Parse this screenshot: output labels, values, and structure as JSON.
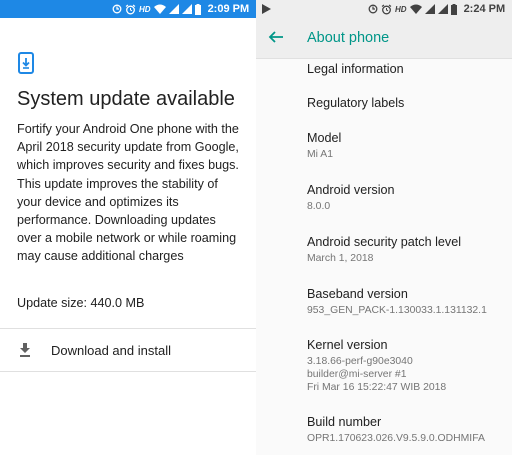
{
  "left_panel": {
    "status_bar": {
      "time": "2:09 PM",
      "network": "HD"
    },
    "title": "System update available",
    "description": "Fortify your Android One phone with the April 2018 security update from Google, which improves security and fixes bugs. This update improves the stability of your device and optimizes its performance. Downloading updates over a mobile network or while roaming may cause additional charges",
    "update_size": "Update size: 440.0 MB",
    "download_button": "Download and install",
    "colors": {
      "status_bar": "#1e88e5",
      "icon": "#1e88e5"
    }
  },
  "right_panel": {
    "status_bar": {
      "time": "2:24 PM",
      "network": "HD"
    },
    "title": "About phone",
    "items": [
      {
        "title": "Legal information"
      },
      {
        "title": "Regulatory labels"
      },
      {
        "title": "Model",
        "summary": "Mi A1"
      },
      {
        "title": "Android version",
        "summary": "8.0.0"
      },
      {
        "title": "Android security patch level",
        "summary": "March 1, 2018"
      },
      {
        "title": "Baseband version",
        "summary": "953_GEN_PACK-1.130033.1.131132.1"
      },
      {
        "title": "Kernel version",
        "summary_lines": [
          "3.18.66-perf-g90e3040",
          "builder@mi-server #1",
          "Fri Mar 16 15:22:47 WIB 2018"
        ]
      },
      {
        "title": "Build number",
        "summary": "OPR1.170623.026.V9.5.9.0.ODHMIFA"
      }
    ],
    "colors": {
      "accent": "#009688",
      "app_bar": "#eeeeee"
    }
  },
  "icons": [
    "phone-download-icon",
    "download-icon",
    "back-arrow-icon",
    "alarm-icon",
    "wifi-icon",
    "signal-icon",
    "battery-icon",
    "play-icon"
  ]
}
